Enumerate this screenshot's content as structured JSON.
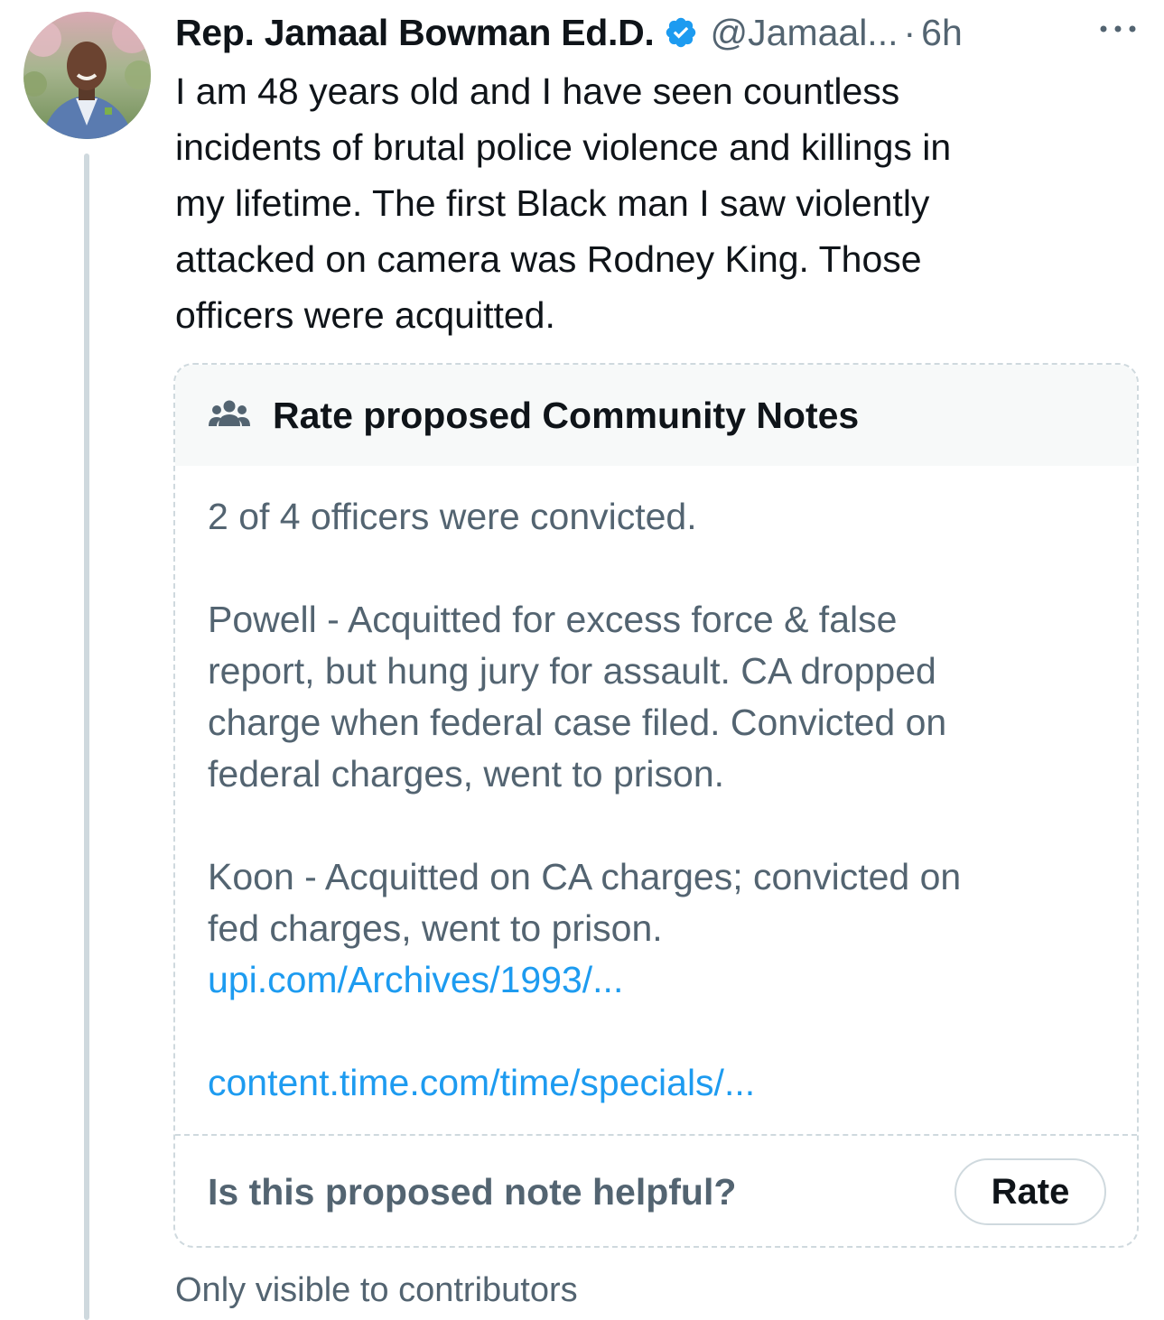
{
  "tweet": {
    "display_name": "Rep. Jamaal Bowman Ed.D.",
    "handle": "@Jamaal...",
    "separator": "·",
    "time": "6h",
    "text_lines": [
      "I am 48 years old and I have seen countless",
      "incidents of brutal police violence and killings in",
      "my lifetime. The first Black man I saw violently",
      "attacked on camera was Rodney King. Those",
      "officers were acquitted."
    ],
    "avatar_icon": "user-avatar",
    "verified_icon": "verified-badge-icon",
    "more_icon": "more-horizontal-icon"
  },
  "community_note": {
    "header_icon": "community-people-icon",
    "header_title": "Rate proposed Community Notes",
    "body_line1": "2 of 4 officers were convicted.",
    "para_powell": [
      "Powell - Acquitted for excess force & false",
      "report, but hung jury for assault. CA dropped",
      "charge when federal case filed. Convicted on",
      "federal charges, went to prison."
    ],
    "para_koon": [
      "Koon - Acquitted on CA charges; convicted on",
      "fed charges, went to prison."
    ],
    "link1": "upi.com/Archives/1993/...",
    "link2": "content.time.com/time/specials/...",
    "question": "Is this proposed note helpful?",
    "rate_button": "Rate"
  },
  "visibility_note": "Only visible to contributors",
  "colors": {
    "text_primary": "#0f1419",
    "text_secondary": "#536471",
    "link": "#1d9bf0",
    "verified": "#1d9bf0",
    "border": "#cfd9de",
    "note_header_bg": "#f7f9f9"
  }
}
